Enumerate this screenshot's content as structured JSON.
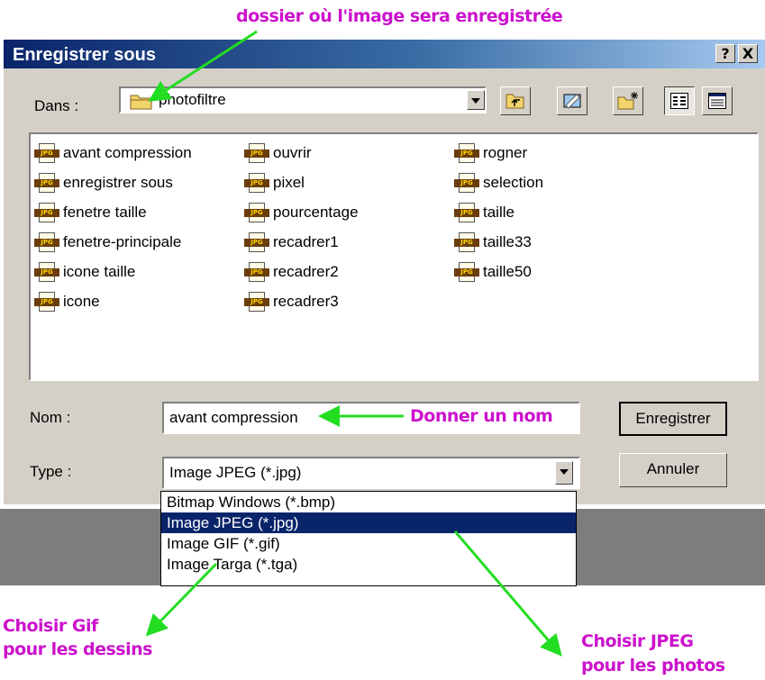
{
  "annotations": {
    "folder_note": "dossier où l'image sera enregistrée",
    "name_note": "Donner un nom",
    "gif_note_line1": "Choisir Gif",
    "gif_note_line2": "pour les dessins",
    "jpeg_note_line1": "Choisir JPEG",
    "jpeg_note_line2": "pour les photos",
    "accent_color": "#cc11cc",
    "arrow_color": "#22dd22"
  },
  "dialog": {
    "title": "Enregistrer sous",
    "help_button": "?",
    "close_button": "X",
    "look_in_label": "Dans :",
    "current_folder": "photofiltre",
    "toolbar_icons": [
      "up-one-level-icon",
      "desktop-icon",
      "new-folder-icon",
      "list-view-icon",
      "details-view-icon"
    ],
    "files": [
      {
        "name": "avant compression"
      },
      {
        "name": "enregistrer sous"
      },
      {
        "name": "fenetre taille"
      },
      {
        "name": "fenetre-principale"
      },
      {
        "name": "icone taille"
      },
      {
        "name": "icone"
      },
      {
        "name": "ouvrir"
      },
      {
        "name": "pixel"
      },
      {
        "name": "pourcentage"
      },
      {
        "name": "recadrer1"
      },
      {
        "name": "recadrer2"
      },
      {
        "name": "recadrer3"
      },
      {
        "name": "rogner"
      },
      {
        "name": "selection"
      },
      {
        "name": "taille"
      },
      {
        "name": "taille33"
      },
      {
        "name": "taille50"
      }
    ],
    "file_icon_label": "JPG",
    "name_label": "Nom :",
    "name_value": "avant compression",
    "type_label": "Type :",
    "type_value": "Image JPEG (*.jpg)",
    "save_button": "Enregistrer",
    "cancel_button": "Annuler",
    "type_options": [
      {
        "label": "Bitmap Windows (*.bmp)",
        "selected": false
      },
      {
        "label": "Image JPEG (*.jpg)",
        "selected": true
      },
      {
        "label": "Image GIF (*.gif)",
        "selected": false
      },
      {
        "label": "Image Targa (*.tga)",
        "selected": false
      }
    ],
    "selection_color": "#0a246a"
  }
}
